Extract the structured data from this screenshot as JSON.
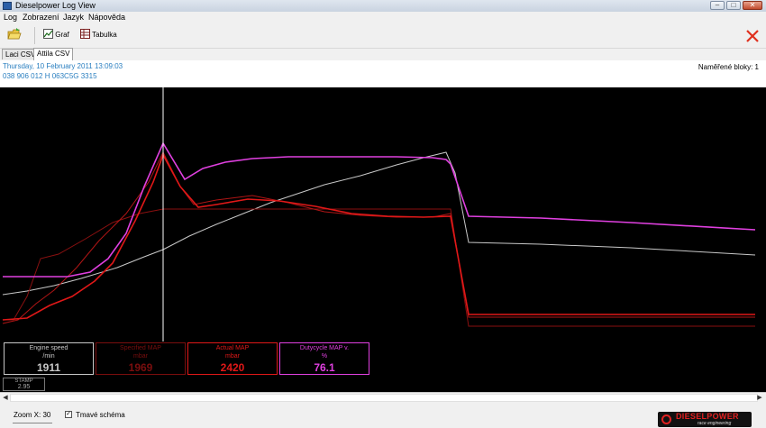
{
  "window": {
    "title": "Dieselpower Log View",
    "controls": {
      "minimize": "–",
      "maximize": "□",
      "close": "✕"
    }
  },
  "menu": [
    "Log",
    "Zobrazení",
    "Jazyk",
    "Nápověda"
  ],
  "toolbar": {
    "open_icon": "folder-open-icon",
    "graph_label": "Graf",
    "table_label": "Tabulka",
    "close_icon": "red-x-icon"
  },
  "tabs": [
    {
      "label": "Laci CSV",
      "active": false
    },
    {
      "label": "Attila CSV",
      "active": true
    }
  ],
  "info": {
    "line1": "Thursday, 10 February 2011 13:09:03",
    "line2": "038 906 012 H  063C5G  3315",
    "blocks": "Naměřené bloky: 1"
  },
  "gauges": [
    {
      "label": "Engine speed",
      "unit": "/min",
      "value": "1911",
      "color": "#c8c8c8"
    },
    {
      "label": "Specified MAP",
      "unit": "mbar",
      "value": "1969",
      "color": "#7a0e0e"
    },
    {
      "label": "Actual MAP",
      "unit": "mbar",
      "value": "2420",
      "color": "#e01818"
    },
    {
      "label": "Dutycycle MAP v.",
      "unit": "%",
      "value": "76.1",
      "color": "#e040e0"
    }
  ],
  "stamp": {
    "label": "STAMP",
    "value": "2.95"
  },
  "status": {
    "zoom": "Zoom X: 30",
    "dark_scheme_label": "Tmavé schéma",
    "dark_scheme_checked": true
  },
  "logo": {
    "name": "DIESELPOWER",
    "tagline": "race engineering"
  },
  "colors": {
    "engine_speed": "#c8c8c8",
    "specified_map": "#9a1010",
    "actual_map": "#e01818",
    "dutycycle": "#e040e0",
    "background": "#000000"
  }
}
